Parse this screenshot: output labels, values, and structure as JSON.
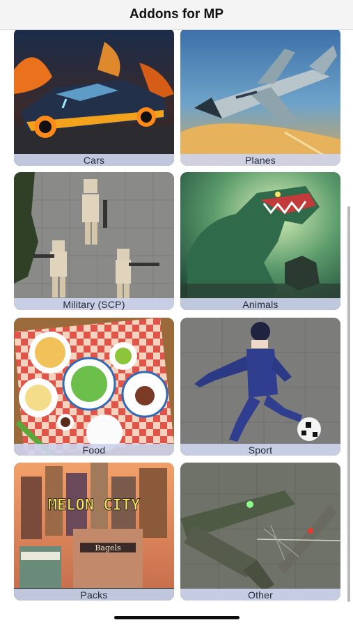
{
  "navbar": {
    "title": "Addons for MP"
  },
  "categories": [
    {
      "label": "Cars"
    },
    {
      "label": "Planes"
    },
    {
      "label": "Military (SCP)"
    },
    {
      "label": "Animals"
    },
    {
      "label": "Food"
    },
    {
      "label": "Sport"
    },
    {
      "label": "Packs",
      "sign_text": "MELON CITY",
      "shop_text": "Bagels"
    },
    {
      "label": "Other"
    }
  ]
}
